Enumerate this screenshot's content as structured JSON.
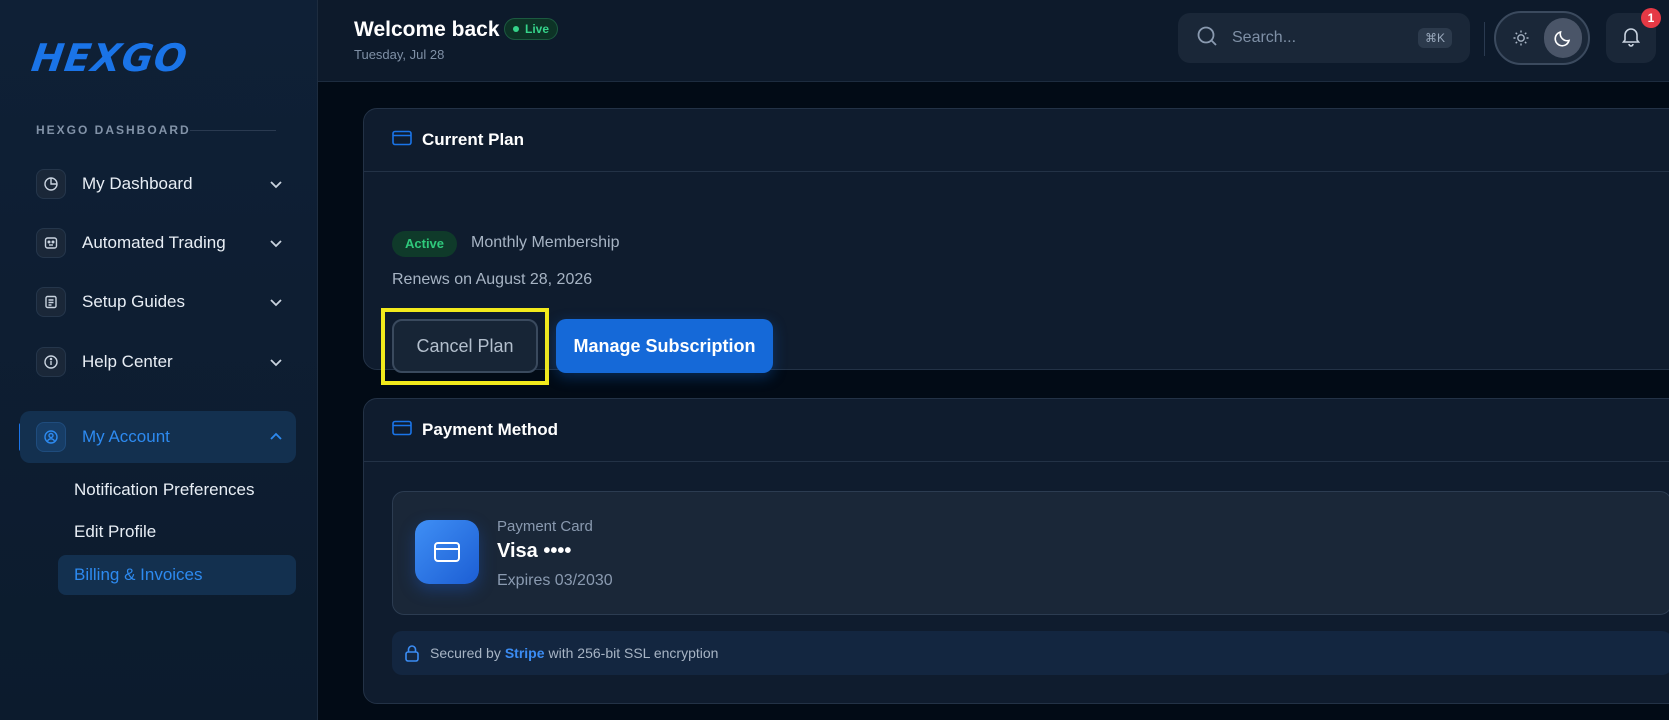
{
  "brand": {
    "logo": "HEXGO",
    "section_label": "HEXGO DASHBOARD"
  },
  "sidebar": {
    "items": [
      {
        "label": "My Dashboard",
        "icon": "pie-chart-icon"
      },
      {
        "label": "Automated Trading",
        "icon": "bot-icon"
      },
      {
        "label": "Setup Guides",
        "icon": "document-icon"
      },
      {
        "label": "Help Center",
        "icon": "info-icon"
      },
      {
        "label": "My Account",
        "icon": "user-circle-icon"
      }
    ],
    "sub_items": [
      {
        "label": "Notification Preferences"
      },
      {
        "label": "Edit Profile"
      },
      {
        "label": "Billing & Invoices"
      }
    ]
  },
  "header": {
    "title": "Welcome back",
    "live_label": "Live",
    "date": "Tuesday, Jul 28",
    "search_placeholder": "Search...",
    "search_shortcut": "⌘K",
    "notification_count": "1"
  },
  "current_plan": {
    "title": "Current Plan",
    "status": "Active",
    "plan_name": "Monthly Membership",
    "renews": "Renews on August 28, 2026",
    "cancel_label": "Cancel Plan",
    "manage_label": "Manage Subscription"
  },
  "payment_method": {
    "title": "Payment Method",
    "card_label": "Payment Card",
    "card_name": "Visa ••••",
    "expires": "Expires 03/2030",
    "secure_prefix": "Secured by",
    "secure_brand": "Stripe",
    "secure_suffix": "with 256-bit SSL encryption"
  },
  "colors": {
    "accent": "#1a74e8",
    "success": "#2fc97c",
    "highlight": "#f2ea1c",
    "badge": "#e53945"
  }
}
